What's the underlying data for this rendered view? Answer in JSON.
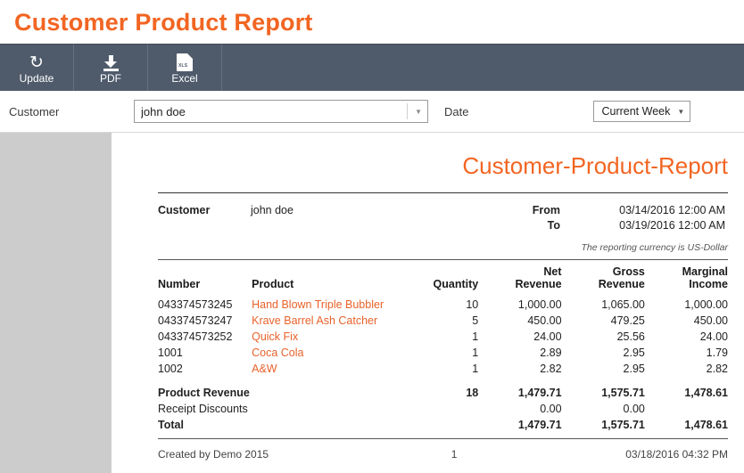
{
  "app": {
    "title": "Customer Product Report"
  },
  "toolbar": {
    "buttons": [
      {
        "label": "Update",
        "icon": "refresh-icon"
      },
      {
        "label": "PDF",
        "icon": "download-icon"
      },
      {
        "label": "Excel",
        "icon": "xls-file-icon"
      }
    ]
  },
  "filters": {
    "customer_label": "Customer",
    "customer_value": "john doe",
    "customer_placeholder": "",
    "date_label": "Date",
    "date_value": "Current Week"
  },
  "report": {
    "title": "Customer-Product-Report",
    "customer_label": "Customer",
    "customer_value": "john doe",
    "from_label": "From",
    "to_label": "To",
    "from_value": "03/14/2016 12:00 AM",
    "to_value": "03/19/2016 12:00 AM",
    "currency_note": "The reporting currency is US-Dollar",
    "columns": {
      "number": "Number",
      "product": "Product",
      "quantity": "Quantity",
      "net_revenue_1": "Net",
      "net_revenue_2": "Revenue",
      "gross_revenue_1": "Gross",
      "gross_revenue_2": "Revenue",
      "marginal_income_1": "Marginal",
      "marginal_income_2": "Income"
    },
    "rows": [
      {
        "number": "043374573245",
        "product": "Hand Blown Triple Bubbler",
        "quantity": "10",
        "net": "1,000.00",
        "gross": "1,065.00",
        "marginal": "1,000.00"
      },
      {
        "number": "043374573247",
        "product": "Krave Barrel Ash Catcher",
        "quantity": "5",
        "net": "450.00",
        "gross": "479.25",
        "marginal": "450.00"
      },
      {
        "number": "043374573252",
        "product": "Quick Fix",
        "quantity": "1",
        "net": "24.00",
        "gross": "25.56",
        "marginal": "24.00"
      },
      {
        "number": "1001",
        "product": "Coca Cola",
        "quantity": "1",
        "net": "2.89",
        "gross": "2.95",
        "marginal": "1.79"
      },
      {
        "number": "1002",
        "product": "A&W",
        "quantity": "1",
        "net": "2.82",
        "gross": "2.95",
        "marginal": "2.82"
      }
    ],
    "summary": [
      {
        "label": "Product Revenue",
        "bold": true,
        "quantity": "18",
        "net": "1,479.71",
        "gross": "1,575.71",
        "marginal": "1,478.61"
      },
      {
        "label": "Receipt Discounts",
        "bold": false,
        "quantity": "",
        "net": "0.00",
        "gross": "0.00",
        "marginal": ""
      },
      {
        "label": "Total",
        "bold": true,
        "quantity": "",
        "net": "1,479.71",
        "gross": "1,575.71",
        "marginal": "1,478.61"
      }
    ],
    "footer": {
      "created": "Created by Demo 2015",
      "page": "1",
      "timestamp": "03/18/2016 04:32 PM"
    }
  },
  "colors": {
    "accent": "#f26522",
    "toolbar": "#4f5b6b",
    "product_text": "#e8622a",
    "page_bg": "#cccccc"
  }
}
